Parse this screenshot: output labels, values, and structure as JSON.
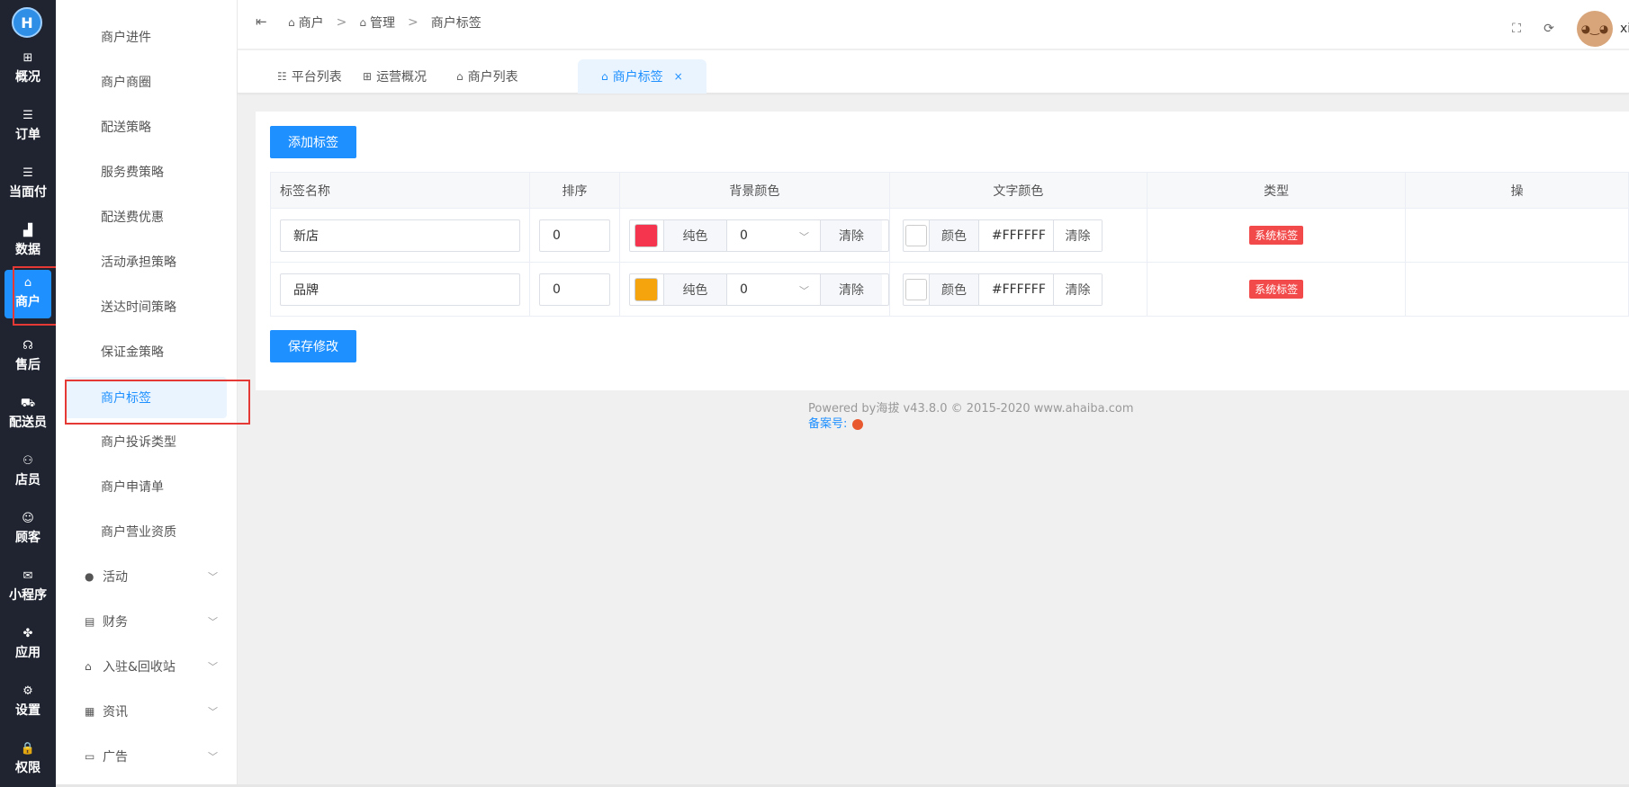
{
  "logo_text": "H",
  "rail": [
    {
      "label": "概况",
      "icon": "⊞",
      "icon_name": "dashboard-icon"
    },
    {
      "label": "订单",
      "icon": "☰",
      "icon_name": "order-list-icon"
    },
    {
      "label": "当面付",
      "icon": "☰",
      "icon_name": "payment-list-icon"
    },
    {
      "label": "数据",
      "icon": "▟",
      "icon_name": "data-chart-icon"
    },
    {
      "label": "商户",
      "icon": "⌂",
      "icon_name": "store-icon",
      "active": true
    },
    {
      "label": "售后",
      "icon": "☊",
      "icon_name": "headset-icon"
    },
    {
      "label": "配送员",
      "icon": "⛟",
      "icon_name": "delivery-icon"
    },
    {
      "label": "店员",
      "icon": "⚇",
      "icon_name": "staff-icon"
    },
    {
      "label": "顾客",
      "icon": "☺",
      "icon_name": "customer-icon"
    },
    {
      "label": "小程序",
      "icon": "✉",
      "icon_name": "mini-program-icon"
    },
    {
      "label": "应用",
      "icon": "✤",
      "icon_name": "apps-icon"
    },
    {
      "label": "设置",
      "icon": "⚙",
      "icon_name": "settings-icon"
    },
    {
      "label": "权限",
      "icon": "🔒",
      "icon_name": "lock-icon"
    }
  ],
  "submenu": {
    "items": [
      "商户进件",
      "商户商圈",
      "配送策略",
      "服务费策略",
      "配送费优惠",
      "活动承担策略",
      "送达时间策略",
      "保证金策略",
      "商户标签",
      "商户投诉类型",
      "商户申请单",
      "商户营业资质"
    ],
    "active_index": 8,
    "groups": [
      {
        "label": "活动",
        "icon": "●",
        "icon_name": "activity-icon"
      },
      {
        "label": "财务",
        "icon": "▤",
        "icon_name": "finance-icon"
      },
      {
        "label": "入驻&回收站",
        "icon": "⌂",
        "icon_name": "store-icon"
      },
      {
        "label": "资讯",
        "icon": "▦",
        "icon_name": "news-icon"
      },
      {
        "label": "广告",
        "icon": "▭",
        "icon_name": "ad-icon"
      }
    ]
  },
  "header": {
    "breadcrumb": [
      "商户",
      "管理",
      "商户标签"
    ],
    "separator": ">",
    "username": "xia"
  },
  "tabs": [
    {
      "label": "平台列表",
      "icon": "☷"
    },
    {
      "label": "运营概况",
      "icon": "⊞"
    },
    {
      "label": "商户列表",
      "icon": "⌂"
    },
    {
      "label": "商户标签",
      "icon": "⌂",
      "active": true,
      "close": "×"
    }
  ],
  "content": {
    "add_button": "添加标签",
    "save_button": "保存修改",
    "columns": [
      "标签名称",
      "排序",
      "背景颜色",
      "文字颜色",
      "类型",
      "操"
    ],
    "rows": [
      {
        "name": "新店",
        "sort": "0",
        "bg_color": "#f5344e",
        "bg_mode": "纯色",
        "bg_select": "0",
        "bg_clear": "清除",
        "text_swatch": "#ffffff",
        "text_mode": "颜色",
        "text_hex": "#FFFFFF",
        "text_clear": "清除",
        "type": "系统标签"
      },
      {
        "name": "品牌",
        "sort": "0",
        "bg_color": "#f5a40e",
        "bg_mode": "纯色",
        "bg_select": "0",
        "bg_clear": "清除",
        "text_swatch": "#ffffff",
        "text_mode": "颜色",
        "text_hex": "#FFFFFF",
        "text_clear": "清除",
        "type": "系统标签"
      }
    ]
  },
  "footer": {
    "powered": "Powered by海拔 v43.8.0 © 2015-2020 www.ahaiba.com",
    "beian": "备案号:"
  },
  "colors": {
    "accent": "#1e90ff",
    "rail_bg": "#1f2430",
    "badge": "#f24a4a",
    "highlight_box": "#e53935"
  }
}
